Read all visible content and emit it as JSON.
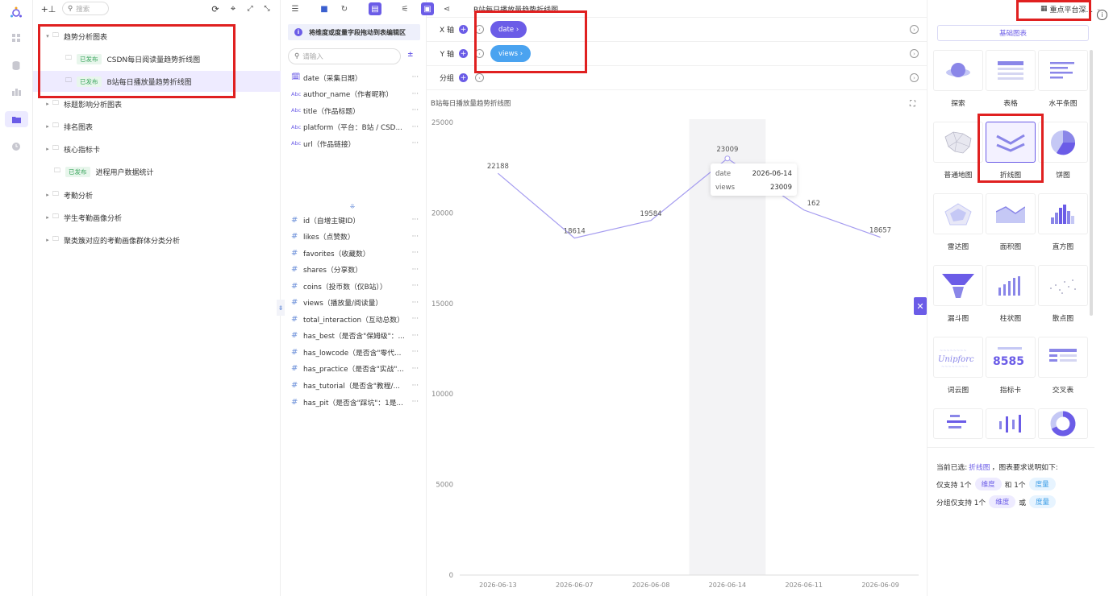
{
  "rail": {
    "items": [
      "apps-icon",
      "database-icon",
      "dashboard-icon",
      "folder-icon",
      "clock-icon"
    ]
  },
  "tree": {
    "search_placeholder": "搜索",
    "badge": "已发布",
    "nodes": [
      {
        "label": "趋势分析图表",
        "expanded": true
      },
      {
        "label": "CSDN每日阅读量趋势折线图",
        "published": true
      },
      {
        "label": "B站每日播放量趋势折线图",
        "published": true,
        "selected": true
      },
      {
        "label": "标题影响分析图表"
      },
      {
        "label": "排名图表"
      },
      {
        "label": "核心指标卡"
      },
      {
        "label": "进程用户数据统计",
        "published": true
      },
      {
        "label": "考勤分析"
      },
      {
        "label": "学生考勤画像分析"
      },
      {
        "label": "聚类簇对应的考勤画像群体分类分析"
      }
    ]
  },
  "fields": {
    "hint": "将维度或度量字段拖动到表编辑区",
    "search_placeholder": "请输入",
    "dimensions": [
      {
        "type": "date",
        "label": "date（采集日期）"
      },
      {
        "type": "Abc",
        "label": "author_name（作者昵称）"
      },
      {
        "type": "Abc",
        "label": "title（作品标题）"
      },
      {
        "type": "Abc",
        "label": "platform（平台：B站 / CSD..."
      },
      {
        "type": "Abc",
        "label": "url（作品链接）"
      }
    ],
    "measures": [
      {
        "type": "#",
        "label": "id（自增主键ID）"
      },
      {
        "type": "#",
        "label": "likes（点赞数）"
      },
      {
        "type": "#",
        "label": "favorites（收藏数）"
      },
      {
        "type": "#",
        "label": "shares（分享数）"
      },
      {
        "type": "#",
        "label": "coins（投币数（仅B站））"
      },
      {
        "type": "#",
        "label": "views（播放量/阅读量）"
      },
      {
        "type": "#",
        "label": "total_interaction（互动总数）"
      },
      {
        "type": "#",
        "label": "has_best（是否含\"保姆级\"：..."
      },
      {
        "type": "#",
        "label": "has_lowcode（是否含\"零代..."
      },
      {
        "type": "#",
        "label": "has_practice（是否含\"实战\"..."
      },
      {
        "type": "#",
        "label": "has_tutorial（是否含\"教程/..."
      },
      {
        "type": "#",
        "label": "has_pit（是否含\"踩坑\"：1是..."
      }
    ],
    "more": "···"
  },
  "editor": {
    "title": "B站每日播放量趋势折线图",
    "x_label": "X 轴",
    "y_label": "Y 轴",
    "group_label": "分组",
    "x_pill": "date ›",
    "y_pill": "views ›",
    "x_color": "#6b5ce7",
    "y_color": "#4aa3f0"
  },
  "chart_data": {
    "type": "line",
    "title": "B站每日播放量趋势折线图",
    "categories": [
      "2026-06-13",
      "2026-06-07",
      "2026-06-08",
      "2026-06-14",
      "2026-06-11",
      "2026-06-09"
    ],
    "series": [
      {
        "values": [
          22188,
          18614,
          19584,
          23009,
          20162,
          18657
        ]
      }
    ],
    "ylim": [
      0,
      25000
    ],
    "yticks": [
      0,
      5000,
      10000,
      15000,
      20000,
      25000
    ],
    "highlight_index": 3,
    "grid": false,
    "line_color": "#a59cf0",
    "labels": [
      "22188",
      "18614",
      "19584",
      "23009",
      "162",
      "18657"
    ]
  },
  "tooltip": {
    "k1": "date",
    "v1": "2026-06-14",
    "k2": "views",
    "v2": "23009"
  },
  "types": {
    "platform_select": "重点平台深...",
    "tab": "基础图表",
    "items": [
      {
        "label": "探索",
        "icon": "explore-icon"
      },
      {
        "label": "表格",
        "icon": "table-icon"
      },
      {
        "label": "水平条图",
        "icon": "hbar-icon"
      },
      {
        "label": "普通地图",
        "icon": "map-icon"
      },
      {
        "label": "折线图",
        "icon": "line-chart-icon",
        "active": true
      },
      {
        "label": "饼图",
        "icon": "pie-icon"
      },
      {
        "label": "雷达图",
        "icon": "radar-icon"
      },
      {
        "label": "面积图",
        "icon": "area-icon"
      },
      {
        "label": "直方图",
        "icon": "histogram-icon"
      },
      {
        "label": "漏斗图",
        "icon": "funnel-icon"
      },
      {
        "label": "柱状图",
        "icon": "bar-icon"
      },
      {
        "label": "散点图",
        "icon": "scatter-icon"
      },
      {
        "label": "词云图",
        "icon": "wordcloud-icon"
      },
      {
        "label": "指标卡",
        "icon": "kpi-icon"
      },
      {
        "label": "交叉表",
        "icon": "crosstab-icon"
      },
      {
        "label": "",
        "icon": "hbar2-icon"
      },
      {
        "label": "",
        "icon": "bar2-icon"
      },
      {
        "label": "",
        "icon": "donut-icon"
      }
    ],
    "kpi_text": "8585",
    "wordcloud_text": "Unipforc",
    "req_prefix": "当前已选:",
    "req_selected": "折线图",
    "req_suffix": "，图表要求说明如下:",
    "req_line2_a": "仅支持 1个",
    "req_line2_b": "和 1个",
    "req_line3_a": "分组仅支持 1个",
    "req_line3_b": "或",
    "chip_dim": "维度",
    "chip_meas": "度量"
  }
}
